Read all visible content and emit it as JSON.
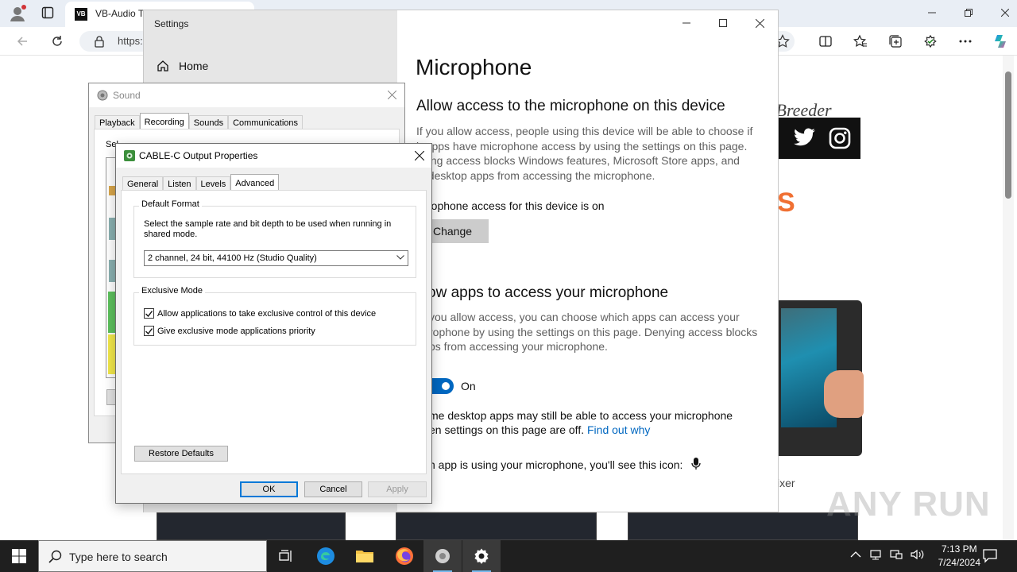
{
  "browser": {
    "tab_title": "VB-Audio T",
    "tab_logo": "VB",
    "url": "https:",
    "icons": [
      "profile-icon",
      "tab-actions-icon",
      "back-icon",
      "refresh-icon",
      "lock-icon",
      "favorite-icon",
      "split-screen-icon",
      "favorites-icon",
      "collections-icon",
      "browser-essentials-icon",
      "more-icon",
      "copilot-icon"
    ]
  },
  "website": {
    "breeder_text": "d Breeder",
    "orange_letter": "S",
    "mixer_text": "ixer",
    "watermark": "ANY RUN"
  },
  "settings": {
    "window_title": "Settings",
    "home_label": "Home",
    "page_title": "Microphone",
    "section1_title": "Allow access to the microphone on this device",
    "section1_desc": "If you allow access, people using this device will be able to choose if\nir apps have microphone access by using the settings on this page.\nnying access blocks Windows features, Microsoft Store apps, and\nst desktop apps from accessing the microphone.",
    "device_status": "rophone access for this device is on",
    "change_button": "Change",
    "section2_title": "ow apps to access your microphone",
    "section2_desc": "you allow access, you can choose which apps can access your\nrophone by using the settings on this page. Denying access blocks\nps from accessing your microphone.",
    "toggle_label": "On",
    "toggle_on": true,
    "desktop_note_line1": "me desktop apps may still be able to access your microphone",
    "desktop_note_line2": "en settings on this page are off.",
    "find_out_link": "Find out why",
    "icon_note": "n app is using your microphone, you'll see this icon:"
  },
  "sound_dialog": {
    "title": "Sound",
    "tabs": [
      "Playback",
      "Recording",
      "Sounds",
      "Communications"
    ],
    "active_tab": "Recording",
    "instruction": "Sel"
  },
  "cable_dialog": {
    "title": "CABLE-C Output Properties",
    "tabs": [
      "General",
      "Listen",
      "Levels",
      "Advanced"
    ],
    "active_tab": "Advanced",
    "default_format_legend": "Default Format",
    "default_format_desc": "Select the sample rate and bit depth to be used when running in shared mode.",
    "format_value": "2 channel, 24 bit, 44100 Hz (Studio Quality)",
    "exclusive_legend": "Exclusive Mode",
    "exclusive_options": [
      {
        "label": "Allow applications to take exclusive control of this device",
        "checked": true
      },
      {
        "label": "Give exclusive mode applications priority",
        "checked": true
      }
    ],
    "restore_button": "Restore Defaults",
    "ok_button": "OK",
    "cancel_button": "Cancel",
    "apply_button": "Apply"
  },
  "taskbar": {
    "search_placeholder": "Type here to search",
    "time": "7:13 PM",
    "date": "7/24/2024"
  },
  "colors": {
    "accent": "#0067c0",
    "taskbar": "#1f1f1f",
    "dialog_focus": "#0078d7"
  }
}
